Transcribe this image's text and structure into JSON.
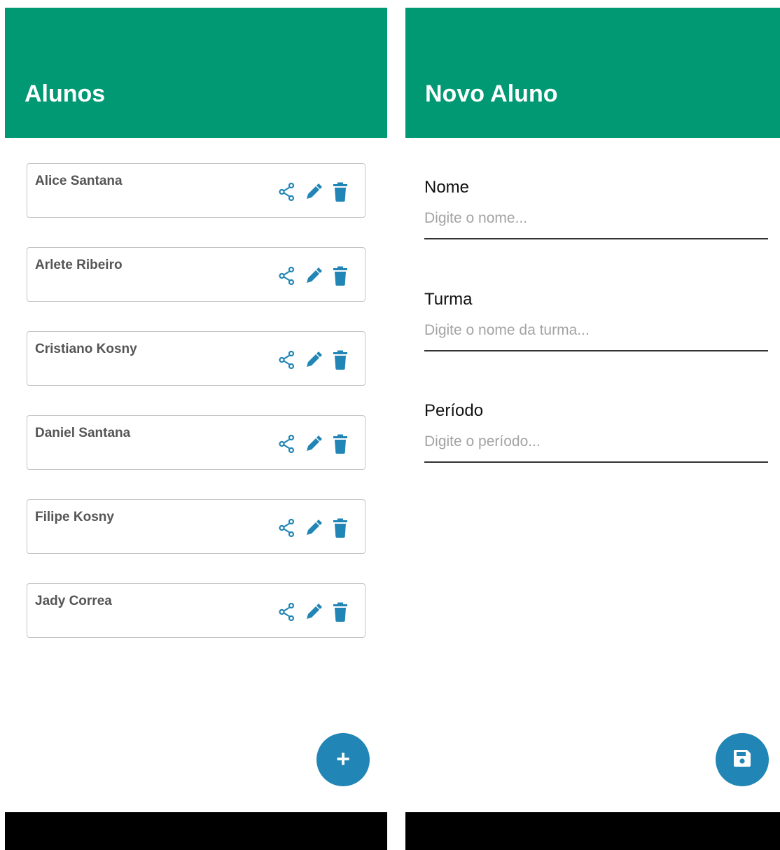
{
  "colors": {
    "header": "#019874",
    "accent": "#2185b5",
    "nav": "#000000"
  },
  "list_screen": {
    "title": "Alunos",
    "students": [
      {
        "name": "Alice Santana"
      },
      {
        "name": "Arlete Ribeiro"
      },
      {
        "name": "Cristiano Kosny"
      },
      {
        "name": "Daniel Santana"
      },
      {
        "name": "Filipe Kosny"
      },
      {
        "name": "Jady Correa"
      }
    ],
    "row_icons": [
      "share-icon",
      "edit-icon",
      "trash-icon"
    ],
    "fab_icon": "plus-icon",
    "fab_symbol": "+"
  },
  "form_screen": {
    "title": "Novo Aluno",
    "fields": [
      {
        "label": "Nome",
        "placeholder": "Digite o nome...",
        "value": ""
      },
      {
        "label": "Turma",
        "placeholder": "Digite o nome da turma...",
        "value": ""
      },
      {
        "label": "Período",
        "placeholder": "Digite o período...",
        "value": ""
      }
    ],
    "fab_icon": "save-icon"
  }
}
